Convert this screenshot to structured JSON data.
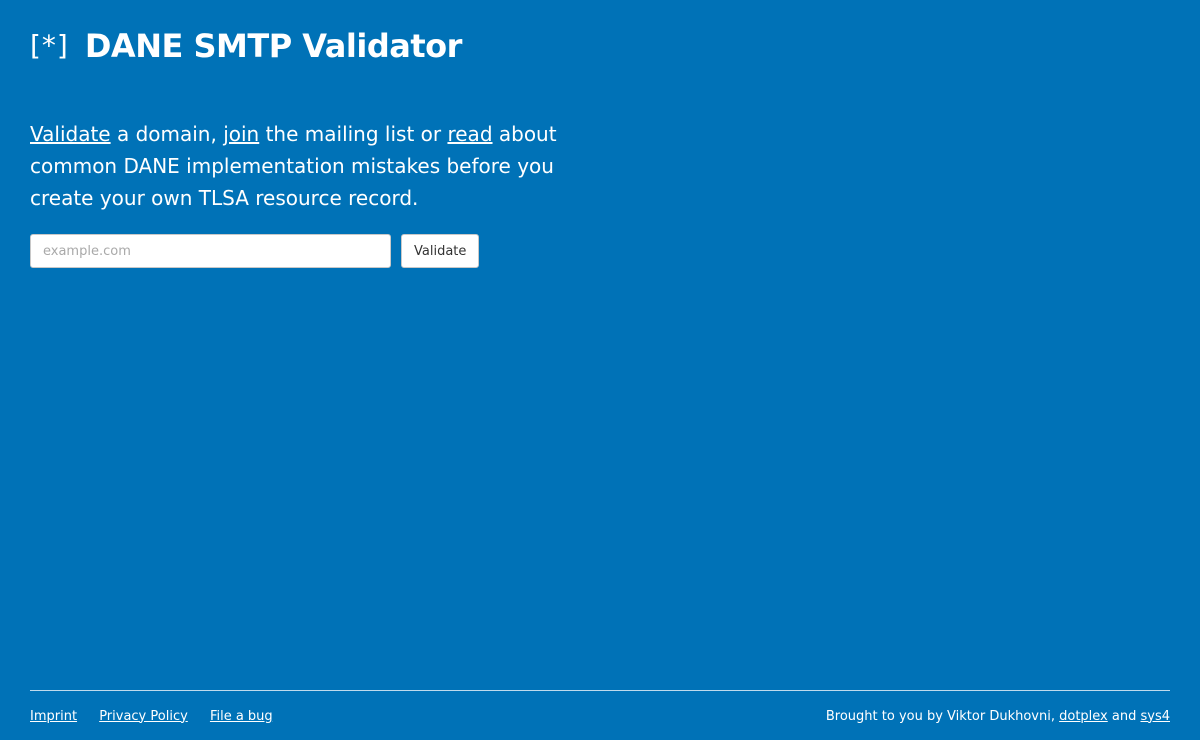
{
  "header": {
    "logo": "[*]",
    "title": "DANE SMTP Validator"
  },
  "intro": {
    "validate_link": "Validate",
    "text1": " a domain, ",
    "join_link": "join",
    "text2": " the mailing list or ",
    "read_link": "read",
    "text3": " about common DANE implementation mistakes before you create your own TLSA resource record."
  },
  "form": {
    "placeholder": "example.com",
    "value": "",
    "button_label": "Validate"
  },
  "footer": {
    "links": {
      "imprint": "Imprint",
      "privacy": "Privacy Policy",
      "bug": "File a bug"
    },
    "credits": {
      "prefix": "Brought to you by Viktor Dukhovni, ",
      "dotplex": "dotplex",
      "and": " and ",
      "sys4": "sys4"
    }
  },
  "colors": {
    "background": "#0072b7",
    "text": "#ffffff"
  }
}
